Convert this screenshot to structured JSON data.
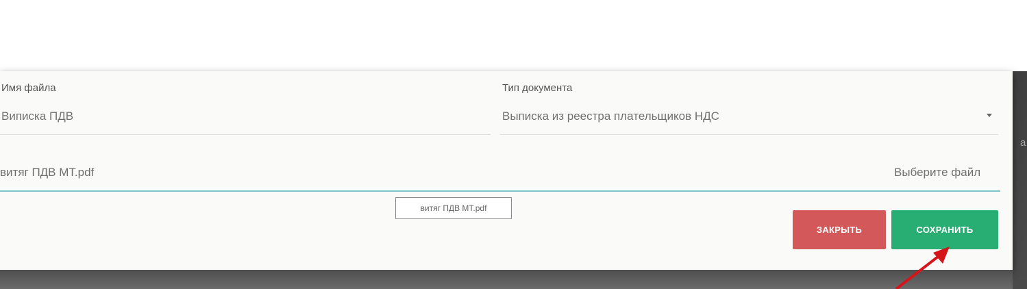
{
  "form": {
    "filename_label": "Имя файла",
    "filename_value": "Виписка ПДВ",
    "doctype_label": "Тип документа",
    "doctype_value": "Выписка из реестра плательщиков НДС",
    "file_value": "витяг ПДВ МТ.pdf",
    "choose_file_label": "Выберите файл",
    "tooltip_text": "витяг ПДВ МТ.pdf"
  },
  "buttons": {
    "close_label": "ЗАКРЫТЬ",
    "save_label": "СОХРАНИТЬ"
  },
  "colors": {
    "close": "#d2585a",
    "save": "#28ad72",
    "focus_underline": "#7ec5c9",
    "arrow": "#d4161b"
  },
  "icons": {
    "dropdown": "caret-down-icon",
    "annotation": "red-arrow-icon"
  }
}
